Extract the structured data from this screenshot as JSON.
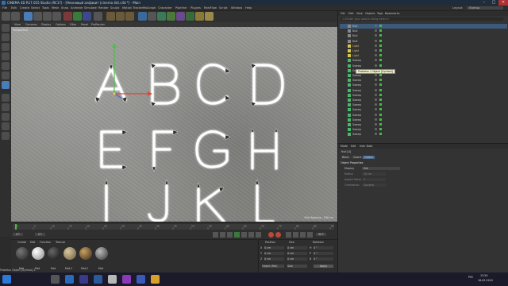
{
  "window": {
    "title": "CINEMA 4D R17.055 Studio (RC17) - [Неоновый алфавит (cinema 4d).c4d *] - Main",
    "min": "–",
    "max": "□",
    "close": "✕"
  },
  "menubar": [
    "File",
    "Edit",
    "Create",
    "Select",
    "Tools",
    "Mesh",
    "Snap",
    "Animate",
    "Simulate",
    "Render",
    "Sculpt",
    "Motion Tracker",
    "MoGraph",
    "Character",
    "Pipeline",
    "Plugins",
    "RealFlow",
    "Script",
    "Window",
    "Help"
  ],
  "layout_label": "Layout:",
  "layout_value": "Startup",
  "viewport": {
    "menu": [
      "View",
      "Cameras",
      "Display",
      "Options",
      "Filter",
      "Panel",
      "ProRender"
    ],
    "camera_label": "Perspective",
    "grid_info": "Grid Spacing : 100 cm",
    "letters": [
      "A",
      "B",
      "C",
      "D",
      "E",
      "F",
      "G",
      "H",
      "I",
      "J",
      "K",
      "L"
    ]
  },
  "timeline": {
    "ticks": [
      "0",
      "5",
      "10",
      "15",
      "20",
      "25",
      "30",
      "35",
      "40",
      "45",
      "50",
      "55",
      "60",
      "65",
      "70",
      "75",
      "80",
      "85",
      "90"
    ],
    "start": "0 F",
    "end": "90 F",
    "current": "0 F"
  },
  "materials": {
    "menu": [
      "Create",
      "Edit",
      "Function",
      "Texture"
    ],
    "items": [
      "Mat",
      "Mat",
      "Mat",
      "Mat.1",
      "Mat.2",
      "Mat"
    ]
  },
  "coordinates": {
    "header": [
      "Position",
      "Size",
      "Rotation"
    ],
    "rows": [
      {
        "axis": "X",
        "pos": "0 cm",
        "size": "0 cm",
        "rot_label": "H",
        "rot": "0 °"
      },
      {
        "axis": "Y",
        "pos": "0 cm",
        "size": "0 cm",
        "rot_label": "P",
        "rot": "0 °"
      },
      {
        "axis": "Z",
        "pos": "0 cm",
        "size": "0 cm",
        "rot_label": "B",
        "rot": "0 °"
      }
    ],
    "mode": "Object (Rel)",
    "size_mode": "Size",
    "apply": "Apply"
  },
  "objects": {
    "tabs": [
      "File",
      "Edit",
      "View",
      "Objects",
      "Tags",
      "Bookmarks"
    ],
    "search_placeholder": "<<Enter your search string here>>",
    "rows": [
      "Null",
      "Null",
      "Null",
      "Null",
      "Light",
      "Light",
      "Light",
      "Sweep",
      "Sweep",
      "Sweep",
      "Sweep",
      "Sweep",
      "Sweep",
      "Sweep",
      "Sweep",
      "Sweep",
      "Sweep",
      "Sweep",
      "Sweep",
      "Sweep",
      "Sweep",
      "Sweep",
      "Sweep"
    ],
    "tooltip": "Probeios / Object [Symbol]"
  },
  "attributes": {
    "tabs": [
      "Mode",
      "Edit",
      "User Data"
    ],
    "object_name": "Null [A]",
    "subtabs": [
      "Basic",
      "Coord.",
      "Object"
    ],
    "section": "Object Properties",
    "props": [
      {
        "label": "Display",
        "value": "Dot"
      },
      {
        "label": "Radius",
        "value": "10 cm"
      },
      {
        "label": "Aspect Ratio",
        "value": "1"
      },
      {
        "label": "Orientation",
        "value": "Camera"
      }
    ]
  },
  "status": "Probeios Object [Symbol] 1",
  "taskbar": {
    "time": "13:50",
    "date": "16.05.2019",
    "lang": "РУС"
  },
  "colors": {
    "accent": "#3d5a7a",
    "neon": "#ffffff",
    "arrow": "#2a2a2a"
  }
}
